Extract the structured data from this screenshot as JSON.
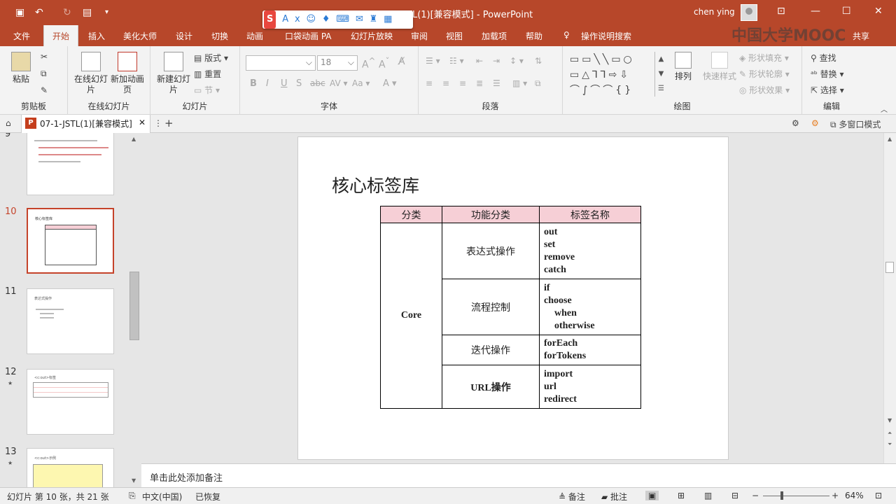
{
  "app": {
    "window_title": "07-1-JSTL(1)[兼容模式] - PowerPoint",
    "user_name": "chen ying",
    "watermark": "中国大学MOOC"
  },
  "menu": {
    "tabs": [
      "文件",
      "开始",
      "插入",
      "美化大师",
      "设计",
      "切换",
      "动画",
      "口袋动画 PA",
      "幻灯片放映",
      "审阅",
      "视图",
      "加载项",
      "帮助"
    ],
    "search": "操作说明搜索",
    "share": "共享"
  },
  "ribbon": {
    "clipboard": {
      "paste": "粘贴",
      "label": "剪贴板"
    },
    "online": {
      "online_slide": "在线幻灯片",
      "new_anim": "新加动画页",
      "label": "在线幻灯片"
    },
    "slides": {
      "new_slide": "新建幻灯片",
      "layout": "版式",
      "reset": "重置",
      "section": "节",
      "label": "幻灯片"
    },
    "font": {
      "size": "18",
      "label": "字体"
    },
    "paragraph": {
      "label": "段落"
    },
    "drawing": {
      "arrange": "排列",
      "quick_styles": "快速样式",
      "fill": "形状填充",
      "outline": "形状轮廓",
      "effects": "形状效果",
      "label": "绘图"
    },
    "editing": {
      "find": "查找",
      "replace": "替换",
      "select": "选择",
      "label": "编辑"
    }
  },
  "doc_tab": {
    "name": "07-1-JSTL(1)[兼容模式]",
    "multiwindow": "多窗口模式"
  },
  "thumbnails": [
    {
      "num": "9"
    },
    {
      "num": "10",
      "title": "核心标签库"
    },
    {
      "num": "11",
      "title": "表达式操作"
    },
    {
      "num": "12",
      "title": "<c:out>标签"
    },
    {
      "num": "13",
      "title": "<c:out>示例"
    }
  ],
  "slide": {
    "title": "核心标签库",
    "table": {
      "headers": [
        "分类",
        "功能分类",
        "标签名称"
      ],
      "category": "Core",
      "rows": [
        {
          "func": "表达式操作",
          "tags": [
            "out",
            "set",
            "remove",
            "catch"
          ]
        },
        {
          "func": "流程控制",
          "tags": [
            "if",
            "choose",
            "when",
            "otherwise"
          ]
        },
        {
          "func": "迭代操作",
          "tags": [
            "forEach",
            "forTokens"
          ]
        },
        {
          "func": "URL操作",
          "tags": [
            "import",
            "url",
            "redirect"
          ]
        }
      ]
    }
  },
  "notes": {
    "placeholder": "单击此处添加备注"
  },
  "status": {
    "slide_info": "幻灯片 第 10 张，共 21 张",
    "language": "中文(中国)",
    "recovered": "已恢复",
    "notes": "备注",
    "comments": "批注",
    "zoom": "64%"
  },
  "colors": {
    "accent": "#b7472a",
    "header_fill": "#f6cfd6"
  }
}
